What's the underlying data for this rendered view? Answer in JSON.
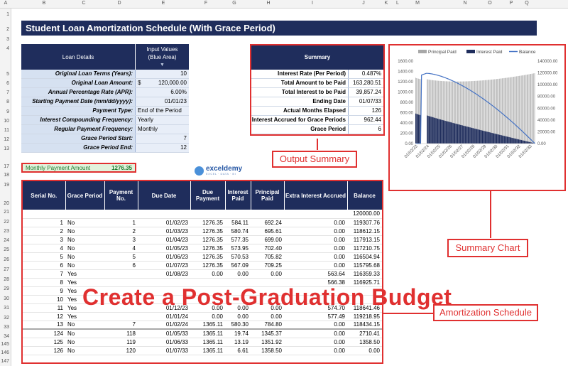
{
  "column_letters": [
    "A",
    "B",
    "C",
    "D",
    "E",
    "F",
    "G",
    "H",
    "I",
    "J",
    "K",
    "L",
    "M",
    "N",
    "O",
    "P",
    "Q"
  ],
  "row_numbers": [
    "1",
    "2",
    "3",
    "4",
    "5",
    "6",
    "7",
    "8",
    "9",
    "10",
    "11",
    "12",
    "13",
    "17",
    "18",
    "19",
    "20",
    "21",
    "22",
    "23",
    "24",
    "25",
    "26",
    "27",
    "28",
    "29",
    "30",
    "31",
    "32",
    "33",
    "34",
    "145",
    "146",
    "147"
  ],
  "title": "Student Loan Amortization Schedule (With Grace Period)",
  "loan_details": {
    "header_left": "Loan Details",
    "header_right_line1": "Input Values",
    "header_right_line2": "(Blue Area)",
    "rows": [
      {
        "label": "Original Loan Terms (Years):",
        "value": "10"
      },
      {
        "label": "Original Loan Amount:",
        "currency": "$",
        "value": "120,000.00"
      },
      {
        "label": "Annual Percentage Rate (APR):",
        "value": "6.00%"
      },
      {
        "label": "Starting Payment Date (mm/dd/yyyy):",
        "value": "01/01/23"
      },
      {
        "label": "Payment Type:",
        "value": "End of the Period"
      },
      {
        "label": "Interest Compounding Frequency:",
        "value": "Yearly"
      },
      {
        "label": "Regular Payment Frequency:",
        "value": "Monthly"
      },
      {
        "label": "Grace Period Start:",
        "value": "7"
      },
      {
        "label": "Grace Period End:",
        "value": "12"
      }
    ]
  },
  "summary": {
    "header": "Summary",
    "rows": [
      {
        "label": "Interest Rate (Per Period)",
        "value": "0.487%"
      },
      {
        "label": "Total Amount to be Paid",
        "value": "163,280.51"
      },
      {
        "label": "Total Interest to be Paid",
        "value": "39,857.24"
      },
      {
        "label": "Ending Date",
        "value": "01/07/33"
      },
      {
        "label": "Actual Months Elapsed",
        "value": "126"
      },
      {
        "label": "Interest Accrued for Grace Periods",
        "value": "962.44"
      },
      {
        "label": "Grace Period",
        "value": "6"
      }
    ]
  },
  "monthly_payment": {
    "label": "Monthly Payment Amount",
    "value": "1276.35"
  },
  "logo": {
    "name": "exceldemy",
    "tagline": "EXCEL · DATA · BI"
  },
  "callouts": {
    "output_summary": "Output Summary",
    "summary_chart": "Summary Chart",
    "amortization_schedule": "Amortization Schedule"
  },
  "amortization": {
    "headers": [
      "Serial No.",
      "Grace Period",
      "Payment No.",
      "Due Date",
      "Due Payment",
      "Interest Paid",
      "Principal Paid",
      "Extra Interest Accrued",
      "Balance"
    ],
    "rows": [
      [
        "",
        "",
        "",
        "",
        "",
        "",
        "",
        "",
        "120000.00"
      ],
      [
        "1",
        "No",
        "1",
        "01/02/23",
        "1276.35",
        "584.11",
        "692.24",
        "0.00",
        "119307.76"
      ],
      [
        "2",
        "No",
        "2",
        "01/03/23",
        "1276.35",
        "580.74",
        "695.61",
        "0.00",
        "118612.15"
      ],
      [
        "3",
        "No",
        "3",
        "01/04/23",
        "1276.35",
        "577.35",
        "699.00",
        "0.00",
        "117913.15"
      ],
      [
        "4",
        "No",
        "4",
        "01/05/23",
        "1276.35",
        "573.95",
        "702.40",
        "0.00",
        "117210.75"
      ],
      [
        "5",
        "No",
        "5",
        "01/06/23",
        "1276.35",
        "570.53",
        "705.82",
        "0.00",
        "116504.94"
      ],
      [
        "6",
        "No",
        "6",
        "01/07/23",
        "1276.35",
        "567.09",
        "709.25",
        "0.00",
        "115795.68"
      ],
      [
        "7",
        "Yes",
        "",
        "01/08/23",
        "0.00",
        "0.00",
        "0.00",
        "563.64",
        "116359.33"
      ],
      [
        "8",
        "Yes",
        "",
        "",
        "",
        "",
        "",
        "566.38",
        "116925.71"
      ],
      [
        "9",
        "Yes",
        "",
        "",
        "",
        "",
        "",
        "",
        ""
      ],
      [
        "10",
        "Yes",
        "",
        "",
        "",
        "",
        "",
        "",
        ""
      ],
      [
        "11",
        "Yes",
        "",
        "01/12/23",
        "0.00",
        "0.00",
        "0.00",
        "574.70",
        "118641.46"
      ],
      [
        "12",
        "Yes",
        "",
        "01/01/24",
        "0.00",
        "0.00",
        "0.00",
        "577.49",
        "119218.95"
      ],
      [
        "13",
        "No",
        "7",
        "01/02/24",
        "1365.11",
        "580.30",
        "784.80",
        "0.00",
        "118434.15"
      ],
      [
        "124",
        "No",
        "118",
        "01/05/33",
        "1365.11",
        "19.74",
        "1345.37",
        "0.00",
        "2710.41"
      ],
      [
        "125",
        "No",
        "119",
        "01/06/33",
        "1365.11",
        "13.19",
        "1351.92",
        "0.00",
        "1358.50"
      ],
      [
        "126",
        "No",
        "120",
        "01/07/33",
        "1365.11",
        "6.61",
        "1358.50",
        "0.00",
        "0.00"
      ]
    ]
  },
  "watermark": "Create a Post-Graduation Budget",
  "chart_data": {
    "type": "bar",
    "legend": [
      "Principal Paid",
      "Interest Paid",
      "Balance"
    ],
    "legend_position": "top",
    "series_colors": {
      "principal": "#a8a8a8",
      "interest": "#1f2d5c",
      "balance": "#4472c4"
    },
    "y_left": {
      "ticks": [
        "0.00",
        "200.00",
        "400.00",
        "600.00",
        "800.00",
        "1000.00",
        "1200.00",
        "1400.00",
        "1600.00"
      ],
      "lim": [
        0,
        1600
      ]
    },
    "y_right": {
      "ticks": [
        "0.00",
        "20000.00",
        "40000.00",
        "60000.00",
        "80000.00",
        "100000.00",
        "120000.00",
        "140000.00"
      ],
      "lim": [
        0,
        140000
      ]
    },
    "x_tick_labels": [
      "01/02/23",
      "01/02/24",
      "01/02/25",
      "01/02/26",
      "01/02/27",
      "01/02/28",
      "01/02/29",
      "01/02/30",
      "01/02/31",
      "01/02/32",
      "01/02/33"
    ],
    "grace_period_months": 6,
    "series": [
      {
        "name": "Principal Paid",
        "start": 692.24,
        "end": 1358.5
      },
      {
        "name": "Interest Paid",
        "start": 584.11,
        "end": 6.61
      },
      {
        "name": "Balance",
        "start": 120000.0,
        "end": 0.0
      }
    ]
  }
}
